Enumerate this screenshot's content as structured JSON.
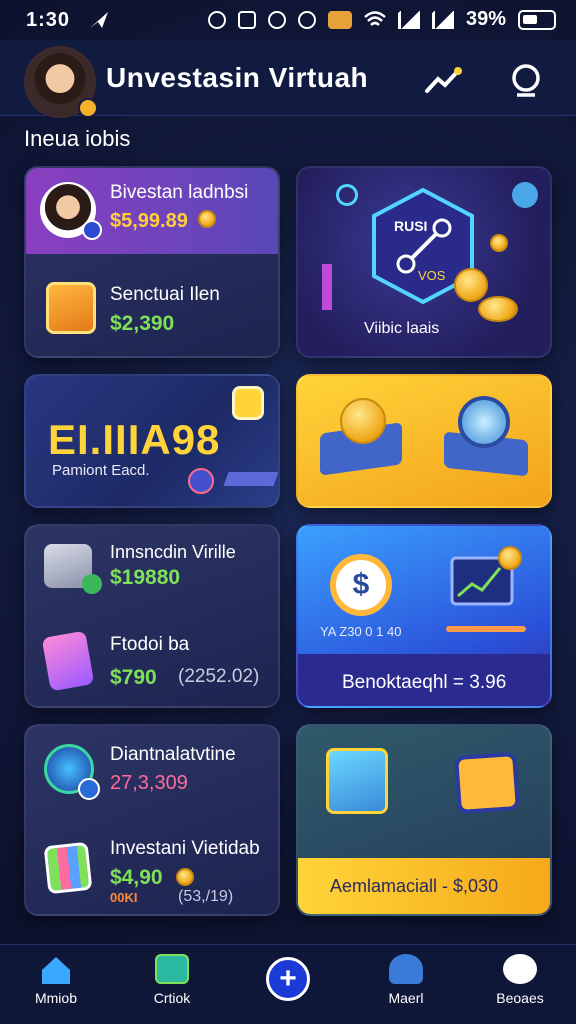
{
  "status_bar": {
    "time": "1:30",
    "battery": "39%"
  },
  "header": {
    "title": "Unvestasin Virtuah"
  },
  "section": {
    "label": "Ineua iobis"
  },
  "cards": {
    "top_left": {
      "title": "Bivestan ladnbsi",
      "amount": "$5,99.89",
      "sub_title": "Senctuai Ilen",
      "sub_amount": "$2,390"
    },
    "top_right": {
      "badge_text": "RUSI",
      "badge_sub": "VOS",
      "caption": "Viibic laais"
    },
    "mid_left": {
      "headline": "EI.IIIA98",
      "caption": "Pamiont Eacd."
    },
    "row3_left": {
      "title": "Innsncdin Virille",
      "amount": "$19880",
      "sub_title": "Ftodoi ba",
      "sub_amount": "$790",
      "sub_extra": "(2252.02)"
    },
    "row3_right": {
      "mini_caption": "YA Z30 0 1 40",
      "footer": "Benoktaeqhl = 3.96"
    },
    "row4_left": {
      "title": "Diantnalatvtine",
      "amount": "27,3,309",
      "sub_title": "Investani Vietidab",
      "sub_amount": "$4,90",
      "sub_small": "00KI",
      "sub_extra": "(53,/19)"
    },
    "row4_right": {
      "footer": "Aemlamaciall - $,030"
    }
  },
  "nav": {
    "items": [
      {
        "label": "Mmiob"
      },
      {
        "label": "Crtiok"
      },
      {
        "label": "Maerl"
      },
      {
        "label": "Beoaes"
      }
    ]
  },
  "colors": {
    "accent_gold": "#ffcf3a",
    "accent_green": "#7fe05a",
    "accent_pink": "#ff6aa0",
    "nav_bg": "#0f1738"
  }
}
